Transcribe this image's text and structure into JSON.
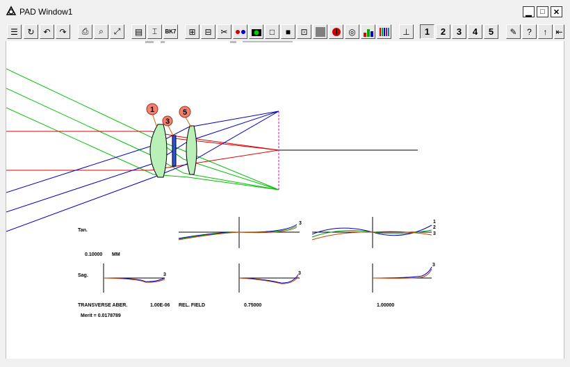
{
  "window": {
    "title": "PAD Window1",
    "minimize_label": "▁",
    "maximize_label": "□",
    "close_label": "✕"
  },
  "toolbar": {
    "field_buttons": [
      "1",
      "2",
      "3",
      "4",
      "5"
    ],
    "glass_label": "BK7"
  },
  "lens_labels": {
    "surface_1": "1",
    "surface_3": "3",
    "surface_5": "5"
  },
  "aberration": {
    "tan_label": "Tan.",
    "sag_label": "Sag.",
    "scale_value": "0.10000",
    "scale_unit": "MM",
    "title": "TRANSVERSE ABER.",
    "wavelength": "1.00E-06",
    "field_label": "REL. FIELD",
    "field_1": "0.75000",
    "field_2": "1.00000",
    "merit": "Merit = 0.0178789",
    "curve_labels": [
      "1",
      "2",
      "3"
    ]
  },
  "colors": {
    "ray_green": "#00c000",
    "ray_red": "#e00000",
    "ray_blue": "#0000c0",
    "lens_fill": "#b8f0b8",
    "label_fill": "#f08070",
    "focus_pink": "#e000e0"
  }
}
